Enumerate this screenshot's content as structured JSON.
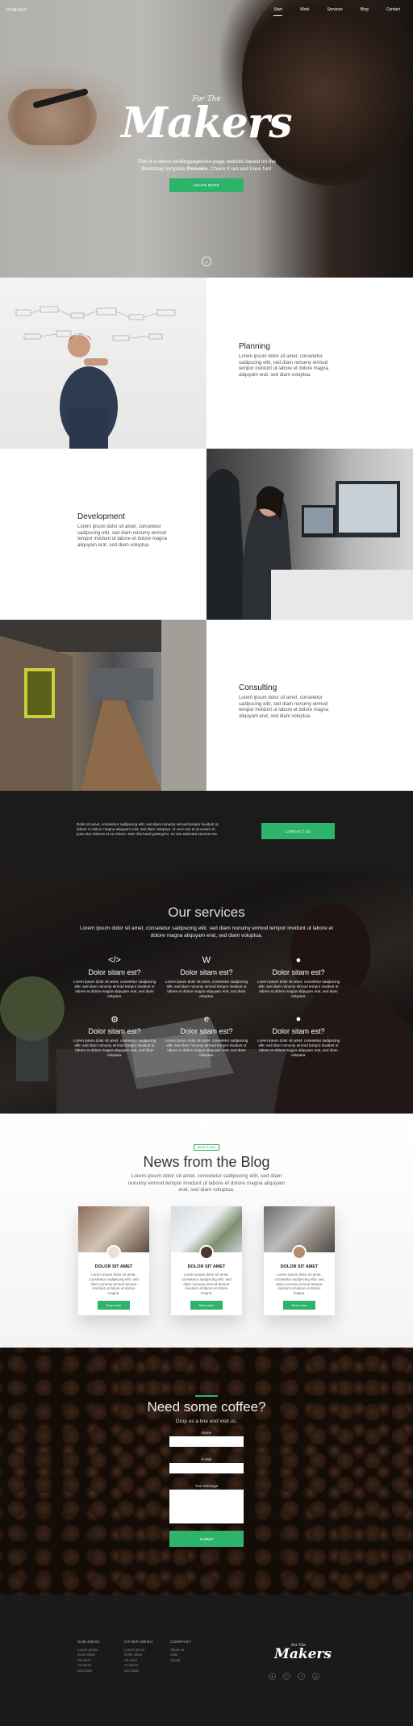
{
  "header": {
    "brand": "POMOKO",
    "nav": [
      {
        "label": "Start"
      },
      {
        "label": "Work"
      },
      {
        "label": "Services"
      },
      {
        "label": "Blog"
      },
      {
        "label": "Contact"
      }
    ]
  },
  "hero": {
    "small_title": "For The",
    "title": "Makers",
    "text_pre": "This is a demo landingpage/one-page website based on the Bootstrap template ",
    "text_bold": "Pomoko",
    "text_post": ". Check it out and have fun!",
    "button": "LEARN MORE",
    "scroll_icon": "chevron-down-icon"
  },
  "features": [
    {
      "title": "Planning",
      "text": "Lorem ipsum dolor sit amet, consetetur sadipscing elitr, sed diam nonumy eirmod tempor invidunt ut labore et dolore magna aliquyam erat, sed diam voluptua."
    },
    {
      "title": "Development",
      "text": "Lorem ipsum dolor sit amet, consetetur sadipscing elitr, sed diam nonumy eirmod tempor invidunt ut labore et dolore magna aliquyam erat, sed diam voluptua."
    },
    {
      "title": "Consulting",
      "text": "Lorem ipsum dolor sit amet, consetetur sadipscing elitr, sed diam nonumy eirmod tempor invidunt ut labore et dolore magna aliquyam erat, sed diam voluptua."
    }
  ],
  "cta": {
    "text": "Dolor sit amet, consetetur sadipscing elitr, sed diam nonumy eirmod tempor invidunt ut labore et dolore magna aliquyam erat, sed diam voluptua. At vero eos et accusam et justo duo dolores et ea rebum. Stet clita kasd gubergren, no sea takimata sanctus est.",
    "button": "CONTACT US"
  },
  "services": {
    "title": "Our services",
    "subtitle": "Lorem ipsum dolor sit amet, consetetur sadipscing elitr, sed diam nonumy eirmod tempor invidunt ut labore et dolore magna aliquyam erat, sed diam voluptua.",
    "items": [
      {
        "icon": "code-icon",
        "glyph": "</>",
        "title": "Dolor sitam est?",
        "text": "Lorem ipsum dolor sit amet, consetetur sadipscing elitr, sed diam nonumy eirmod tempor invidunt ut labore et dolore magna aliquyam erat, sed diam voluptua."
      },
      {
        "icon": "wordpress-icon",
        "glyph": "W",
        "title": "Dolor sitam est?",
        "text": "Lorem ipsum dolor sit amet, consetetur sadipscing elitr, sed diam nonumy eirmod tempor invidunt ut labore et dolore magna aliquyam erat, sed diam voluptua."
      },
      {
        "icon": "github-icon",
        "glyph": "●",
        "title": "Dolor sitam est?",
        "text": "Lorem ipsum dolor sit amet, consetetur sadipscing elitr, sed diam nonumy eirmod tempor invidunt ut labore et dolore magna aliquyam erat, sed diam voluptua."
      },
      {
        "icon": "gears-icon",
        "glyph": "⚙",
        "title": "Dolor sitam est?",
        "text": "Lorem ipsum dolor sit amet, consetetur sadipscing elitr, sed diam nonumy eirmod tempor invidunt ut labore et dolore magna aliquyam erat, sed diam voluptua."
      },
      {
        "icon": "edge-icon",
        "glyph": "e",
        "title": "Dolor sitam est?",
        "text": "Lorem ipsum dolor sit amet, consetetur sadipscing elitr, sed diam nonumy eirmod tempor invidunt ut labore et dolore magna aliquyam erat, sed diam voluptua."
      },
      {
        "icon": "apple-icon",
        "glyph": "●",
        "title": "Dolor sitam est?",
        "text": "Lorem ipsum dolor sit amet, consetetur sadipscing elitr, sed diam nonumy eirmod tempor invidunt ut labore et dolore magna aliquyam erat, sed diam voluptua."
      }
    ]
  },
  "blog": {
    "tag": "WHAT'S NEW",
    "title": "News from the Blog",
    "subtitle": "Lorem ipsum dolor sit amet, consetetur sadipscing elitr, sed diam nonumy eirmod tempor invidunt ut labore et dolore magna aliquyam erat, sed diam voluptua.",
    "cards": [
      {
        "title": "DOLOR SIT AMET",
        "text": "Lorem ipsum dolor sit amet, consetetur sadipscing elitr, sed diam nonumy eirmod tempor invidunt ut labore et dolore magna.",
        "button": "Read more"
      },
      {
        "title": "DOLOR SIT AMET",
        "text": "Lorem ipsum dolor sit amet, consetetur sadipscing elitr, sed diam nonumy eirmod tempor invidunt ut labore et dolore magna.",
        "button": "Read more"
      },
      {
        "title": "DOLOR SIT AMET",
        "text": "Lorem ipsum dolor sit amet, consetetur sadipscing elitr, sed diam nonumy eirmod tempor invidunt ut labore et dolore magna.",
        "button": "Read more"
      }
    ]
  },
  "contact": {
    "title": "Need some coffee?",
    "subtitle": "Drop us a line and visit us.",
    "name_label": "Name",
    "email_label": "E-Mail",
    "message_label": "Your Message",
    "button": "SUBMIT"
  },
  "footer": {
    "columns": [
      {
        "title": "SUB MENU",
        "items": [
          "Lorem ipsum",
          "Dolor sitam",
          "Sit amet",
          "At labore",
          "Sed diam"
        ]
      },
      {
        "title": "OTHER MENU",
        "items": [
          "Lorem ipsum",
          "Dolor sitam",
          "Sit amet",
          "At labore",
          "Sed diam"
        ]
      },
      {
        "title": "COMPANY",
        "items": [
          "About us",
          "Jobs",
          "Social"
        ]
      }
    ],
    "logo_small": "For The",
    "logo": "Makers",
    "social_icons": [
      "github-icon",
      "facebook-icon",
      "twitter-icon",
      "google-plus-icon"
    ]
  },
  "colors": {
    "accent": "#2eb36b",
    "dark": "#1b1b1b"
  }
}
